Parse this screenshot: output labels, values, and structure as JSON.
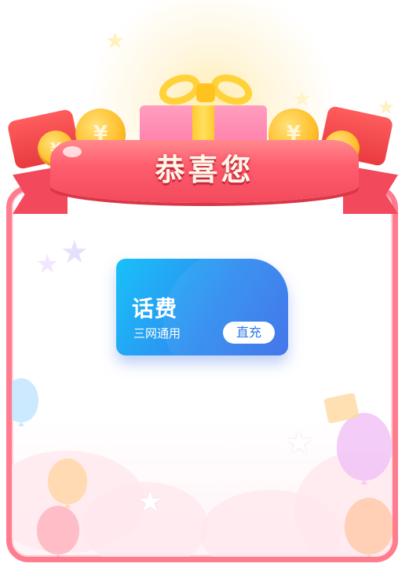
{
  "header": {
    "title": "恭喜您",
    "coin_symbol": "¥"
  },
  "prize": {
    "title": "话费",
    "subtitle": "三网通用",
    "tag": "直充"
  },
  "colors": {
    "frame_border": "#ff7b8e",
    "ribbon": "#f24a5c",
    "voucher_start": "#18c1f8",
    "voucher_end": "#3a6ee8",
    "coin": "#ffc02e"
  },
  "icons": [
    "star-icon",
    "gift-box-icon",
    "coin-icon",
    "red-envelope-icon",
    "balloon-icon",
    "cloud-icon"
  ]
}
